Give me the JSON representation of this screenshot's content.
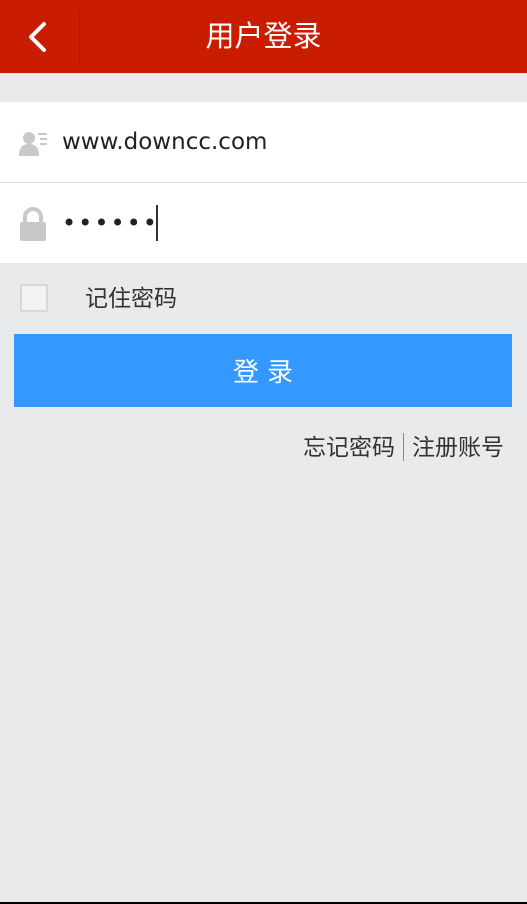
{
  "header": {
    "title": "用户登录",
    "back_icon": "chevron-left-icon",
    "background": "#c91c00"
  },
  "form": {
    "username": {
      "value": "www.downcc.com",
      "icon": "user-card-icon"
    },
    "password": {
      "value": "••••••",
      "icon": "lock-icon"
    }
  },
  "remember": {
    "label": "记住密码",
    "checked": false
  },
  "login_button": {
    "label": "登录",
    "color": "#3399ff"
  },
  "links": {
    "forgot": "忘记密码",
    "register": "注册账号"
  }
}
